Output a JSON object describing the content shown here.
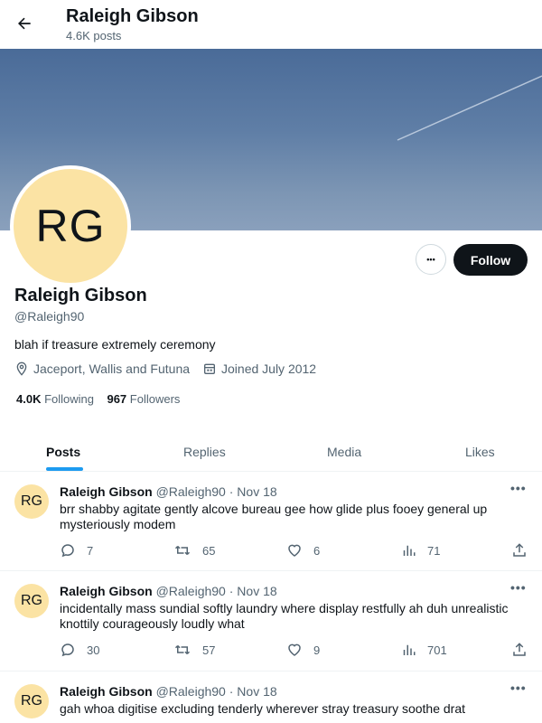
{
  "header": {
    "title": "Raleigh Gibson",
    "posts_count": "4.6K posts"
  },
  "profile": {
    "avatar_initials": "RG",
    "name": "Raleigh Gibson",
    "handle": "@Raleigh90",
    "bio": "blah if treasure extremely ceremony",
    "location": "Jaceport, Wallis and Futuna",
    "joined": "Joined July 2012",
    "following_count": "4.0K",
    "following_label": "Following",
    "followers_count": "967",
    "followers_label": "Followers",
    "more_label": "•••",
    "follow_label": "Follow"
  },
  "tabs": [
    {
      "label": "Posts",
      "active": true
    },
    {
      "label": "Replies",
      "active": false
    },
    {
      "label": "Media",
      "active": false
    },
    {
      "label": "Likes",
      "active": false
    }
  ],
  "tweets": [
    {
      "avatar": "RG",
      "name": "Raleigh Gibson",
      "handle": "@Raleigh90",
      "sep": "·",
      "date": "Nov 18",
      "text": "brr shabby agitate gently alcove bureau gee how glide plus fooey general up mysteriously modem",
      "replies": "7",
      "retweets": "65",
      "likes": "6",
      "views": "71"
    },
    {
      "avatar": "RG",
      "name": "Raleigh Gibson",
      "handle": "@Raleigh90",
      "sep": "·",
      "date": "Nov 18",
      "text": "incidentally mass sundial softly laundry where display restfully ah duh unrealistic knottily courageously loudly what",
      "replies": "30",
      "retweets": "57",
      "likes": "9",
      "views": "701"
    },
    {
      "avatar": "RG",
      "name": "Raleigh Gibson",
      "handle": "@Raleigh90",
      "sep": "·",
      "date": "Nov 18",
      "text": "gah whoa digitise excluding tenderly wherever stray treasury soothe drat"
    }
  ],
  "colors": {
    "accent": "#1d9bf0",
    "avatar_bg": "#fbe3a4",
    "follow_bg": "#0f1419",
    "muted": "#536471"
  }
}
